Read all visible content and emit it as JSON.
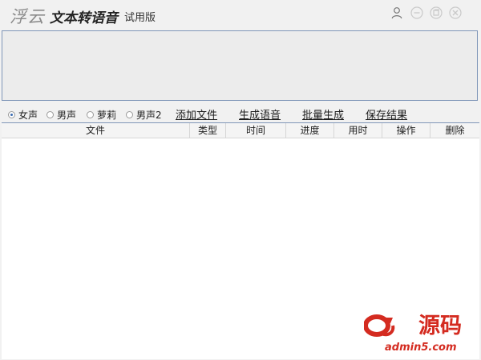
{
  "titlebar": {
    "brand": "浮云",
    "app_title": "文本转语音",
    "edition": "试用版"
  },
  "icons": {
    "user": "user-icon",
    "minimize": "minimize-icon",
    "maximize": "maximize-icon",
    "close": "close-icon"
  },
  "voices": [
    {
      "label": "女声",
      "checked": true
    },
    {
      "label": "男声",
      "checked": false
    },
    {
      "label": "萝莉",
      "checked": false
    },
    {
      "label": "男声2",
      "checked": false
    }
  ],
  "actions": {
    "add_file": "添加文件",
    "generate": "生成语音",
    "batch": "批量生成",
    "save": "保存结果"
  },
  "table": {
    "columns": [
      "文件",
      "类型",
      "时间",
      "进度",
      "用时",
      "操作",
      "删除"
    ]
  },
  "watermark": {
    "logo": "a5",
    "text": "源码",
    "url": "admin5.com"
  },
  "colors": {
    "background": "#f1f1f1",
    "border_accent": "#7f96b8",
    "watermark_red": "#d42b20"
  }
}
